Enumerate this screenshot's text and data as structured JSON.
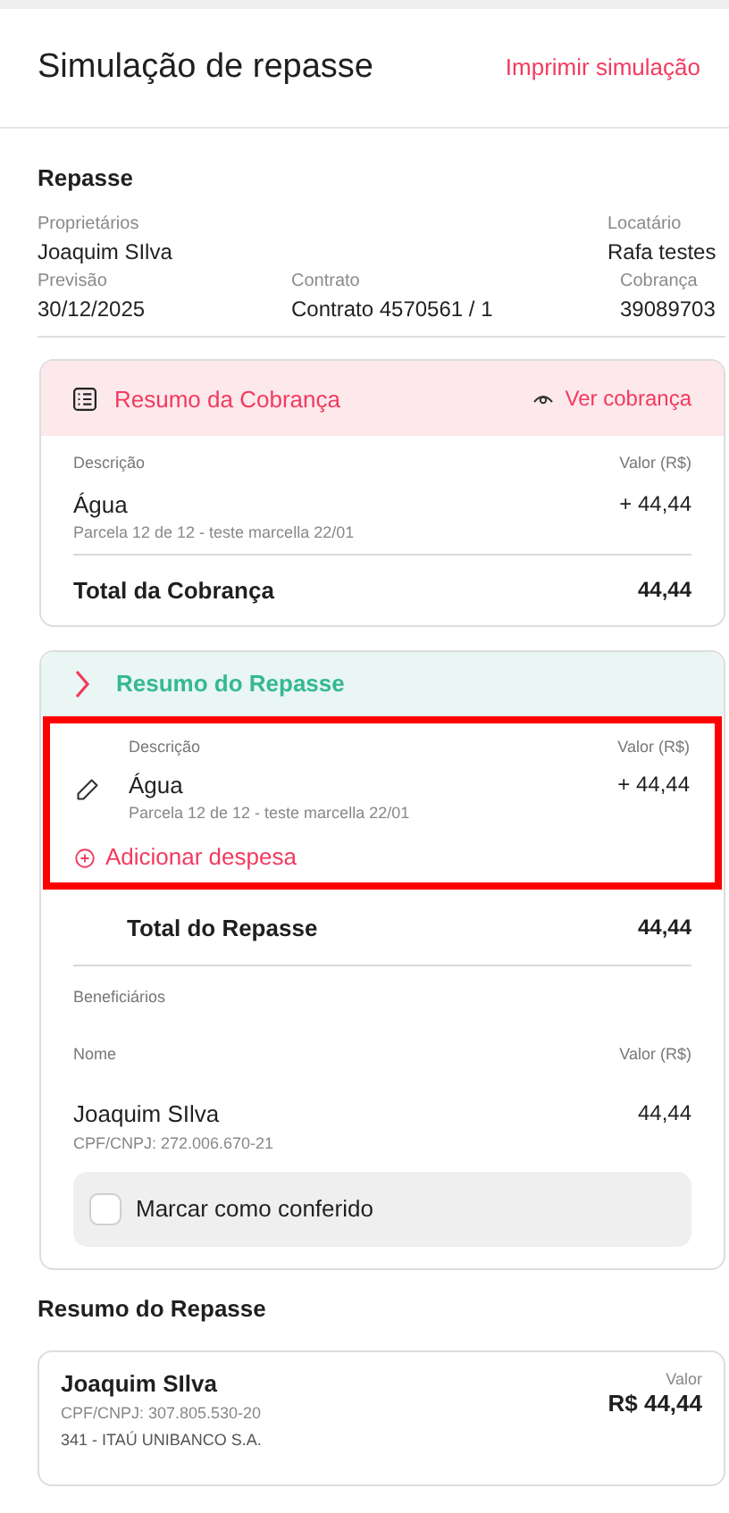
{
  "header": {
    "title": "Simulação de repasse",
    "action": "Imprimir simulação"
  },
  "repasse": {
    "title": "Repasse",
    "fields": [
      {
        "label": "Proprietários",
        "value": "Joaquim SIlva"
      },
      {
        "label": "Locatário",
        "value": "Rafa testes"
      },
      {
        "label": "Previsão",
        "value": "30/12/2025"
      },
      {
        "label": "Contrato",
        "value": "Contrato 4570561 / 1"
      },
      {
        "label": "Cobrança",
        "value": "39089703"
      }
    ]
  },
  "cobranca": {
    "title": "Resumo da Cobrança",
    "action": "Ver cobrança",
    "col_desc": "Descrição",
    "col_value": "Valor (R$)",
    "items": [
      {
        "name": "Água",
        "detail": "Parcela 12 de 12 - teste marcella 22/01",
        "value": "+ 44,44"
      }
    ],
    "total_label": "Total da Cobrança",
    "total": "44,44"
  },
  "resumo": {
    "title": "Resumo do Repasse",
    "expanded": false,
    "highlighted": true,
    "col_desc": "Descrição",
    "col_value": "Valor (R$)",
    "items": [
      {
        "name": "Água",
        "detail": "Parcela 12 de 12 - teste marcella 22/01",
        "value": "+ 44,44"
      }
    ],
    "add_action": "Adicionar despesa",
    "total_label": "Total do Repasse",
    "total": "44,44",
    "beneficiaries_title": "Beneficiários",
    "col_name": "Nome",
    "col_amount": "Valor (R$)",
    "beneficiaries": [
      {
        "name": "Joaquim SIlva",
        "doc": "CPF/CNPJ: 272.006.670-21",
        "value": "44,44"
      }
    ],
    "confirm": {
      "label": "Marcar como conferido",
      "checked": false
    }
  },
  "summary": {
    "title": "Resumo do Repasse",
    "cards": [
      {
        "name": "Joaquim SIlva",
        "doc": "CPF/CNPJ: 307.805.530-20",
        "bank": "341 - ITAÚ UNIBANCO S.A.",
        "value_label": "Valor",
        "value": "R$ 44,44"
      }
    ]
  }
}
